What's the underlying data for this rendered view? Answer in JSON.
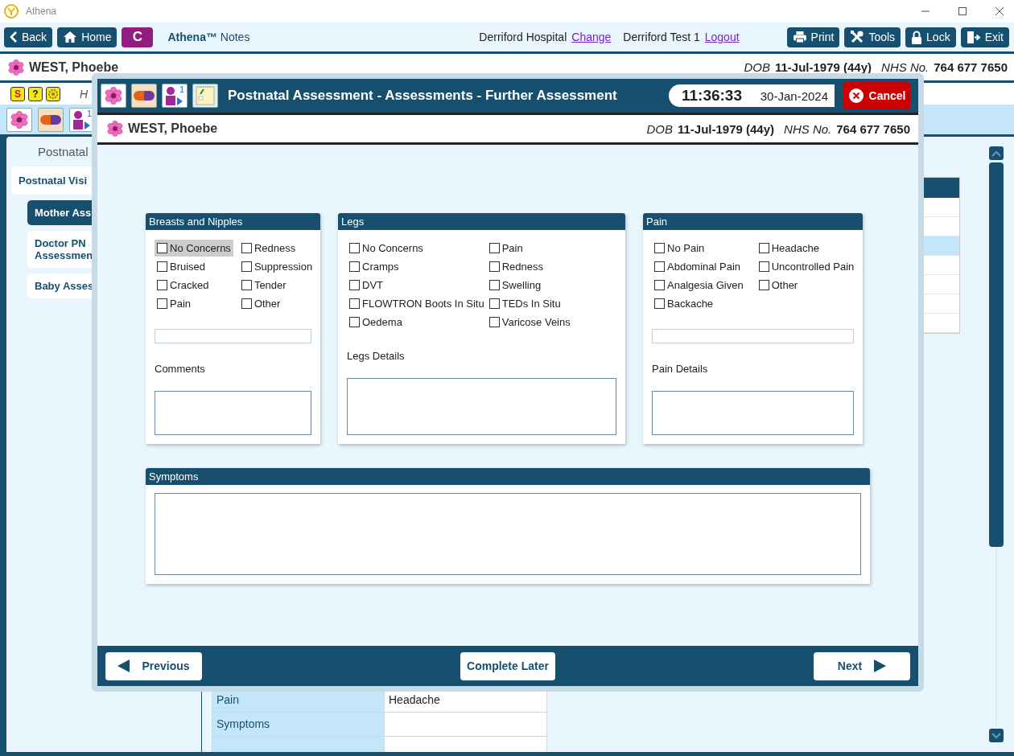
{
  "window": {
    "title": "Athena"
  },
  "toolbar": {
    "nav_buttons": [
      {
        "label": "Back",
        "kind": "back"
      },
      {
        "label": "Home",
        "kind": "home"
      },
      {
        "label": "C",
        "kind": "letter"
      }
    ],
    "app_name": "**Athena™** Notes",
    "location": "Derriford Hospital",
    "location_link": "Change",
    "user": "Derriford Test 1",
    "user_link": "Logout",
    "actions": [
      {
        "label": "Print",
        "kind": "print"
      },
      {
        "label": "Tools",
        "kind": "tools"
      },
      {
        "label": "Lock",
        "kind": "lock"
      },
      {
        "label": "Exit",
        "kind": "exit"
      }
    ]
  },
  "patient": {
    "name": "WEST, Phoebe",
    "dob_label": "DOB",
    "dob": "11-Jul-1979 (44y)",
    "nhs_label": "NHS No.",
    "nhs": "764 677 7650"
  },
  "alert_icons": [
    {
      "kind": "hand",
      "glyph": "S"
    },
    {
      "kind": "help",
      "glyph": "?"
    },
    {
      "kind": "gear"
    }
  ],
  "alert_text": "H",
  "record_icons": [
    {
      "kind": "flower"
    },
    {
      "kind": "pill"
    },
    {
      "kind": "baby",
      "badge": "1"
    }
  ],
  "sidebar": {
    "heading": "Postnatal",
    "items": [
      {
        "label": "Postnatal Visi",
        "selected": false,
        "children": [
          {
            "label": "Mother Ass",
            "selected": true
          },
          {
            "label": "Doctor PN Assessmen",
            "selected": false
          },
          {
            "label": "Baby Asses",
            "selected": false
          }
        ]
      }
    ]
  },
  "detail_table": {
    "rows": [
      {
        "label": "Pain",
        "value": "Headache"
      },
      {
        "label": "Symptoms"
      },
      {}
    ]
  },
  "dialog": {
    "icons": [
      {
        "kind": "flower"
      },
      {
        "kind": "pill"
      },
      {
        "kind": "baby",
        "badge": "1"
      },
      {
        "kind": "note"
      }
    ],
    "title": "Postnatal Assessment - Assessments - Further Assessment",
    "time": "11:36:33",
    "date": "30-Jan-2024",
    "cancel": "Cancel",
    "patient": {
      "name": "WEST, Phoebe",
      "dob_label": "DOB",
      "dob": "11-Jul-1979 (44y)",
      "nhs_label": "NHS No.",
      "nhs": "764 677 7650"
    },
    "panels": [
      {
        "title": "Breasts and Nipples",
        "other_field": true,
        "details_label": "Comments",
        "columns": [
          [
            {
              "label": "No Concerns",
              "checked": false,
              "focused": true
            },
            {
              "label": "Bruised",
              "checked": false,
              "focused": false
            },
            {
              "label": "Cracked",
              "checked": false,
              "focused": false
            },
            {
              "label": "Pain",
              "checked": false,
              "focused": false
            }
          ],
          [
            {
              "label": "Redness",
              "checked": false,
              "focused": false
            },
            {
              "label": "Suppression",
              "checked": false,
              "focused": false
            },
            {
              "label": "Tender",
              "checked": false,
              "focused": false
            },
            {
              "label": "Other",
              "checked": false,
              "focused": false
            }
          ]
        ]
      },
      {
        "title": "Legs",
        "other_field": false,
        "details_label": "Legs Details",
        "columns": [
          [
            {
              "label": "No Concerns",
              "checked": false,
              "focused": false
            },
            {
              "label": "Cramps",
              "checked": false,
              "focused": false
            },
            {
              "label": "DVT",
              "checked": false,
              "focused": false
            },
            {
              "label": "FLOWTRON Boots In Situ",
              "checked": false,
              "focused": false
            },
            {
              "label": "Oedema",
              "checked": false,
              "focused": false
            }
          ],
          [
            {
              "label": "Pain",
              "checked": false,
              "focused": false
            },
            {
              "label": "Redness",
              "checked": false,
              "focused": false
            },
            {
              "label": "Swelling",
              "checked": false,
              "focused": false
            },
            {
              "label": "TEDs In Situ",
              "checked": false,
              "focused": false
            },
            {
              "label": "Varicose Veins",
              "checked": false,
              "focused": false
            }
          ]
        ]
      },
      {
        "title": "Pain",
        "other_field": true,
        "details_label": "Pain Details",
        "columns": [
          [
            {
              "label": "No Pain",
              "checked": false,
              "focused": false
            },
            {
              "label": "Abdominal Pain",
              "checked": false,
              "focused": false
            },
            {
              "label": "Analgesia Given",
              "checked": false,
              "focused": false
            },
            {
              "label": "Backache",
              "checked": false,
              "focused": false
            }
          ],
          [
            {
              "label": "Headache",
              "checked": false,
              "focused": false
            },
            {
              "label": "Uncontrolled Pain",
              "checked": false,
              "focused": false
            },
            {
              "label": "Other",
              "checked": false,
              "focused": false
            }
          ]
        ]
      }
    ],
    "symptoms": {
      "title": "Symptoms"
    },
    "footer": {
      "previous": "Previous",
      "complete": "Complete Later",
      "next": "Next"
    }
  }
}
